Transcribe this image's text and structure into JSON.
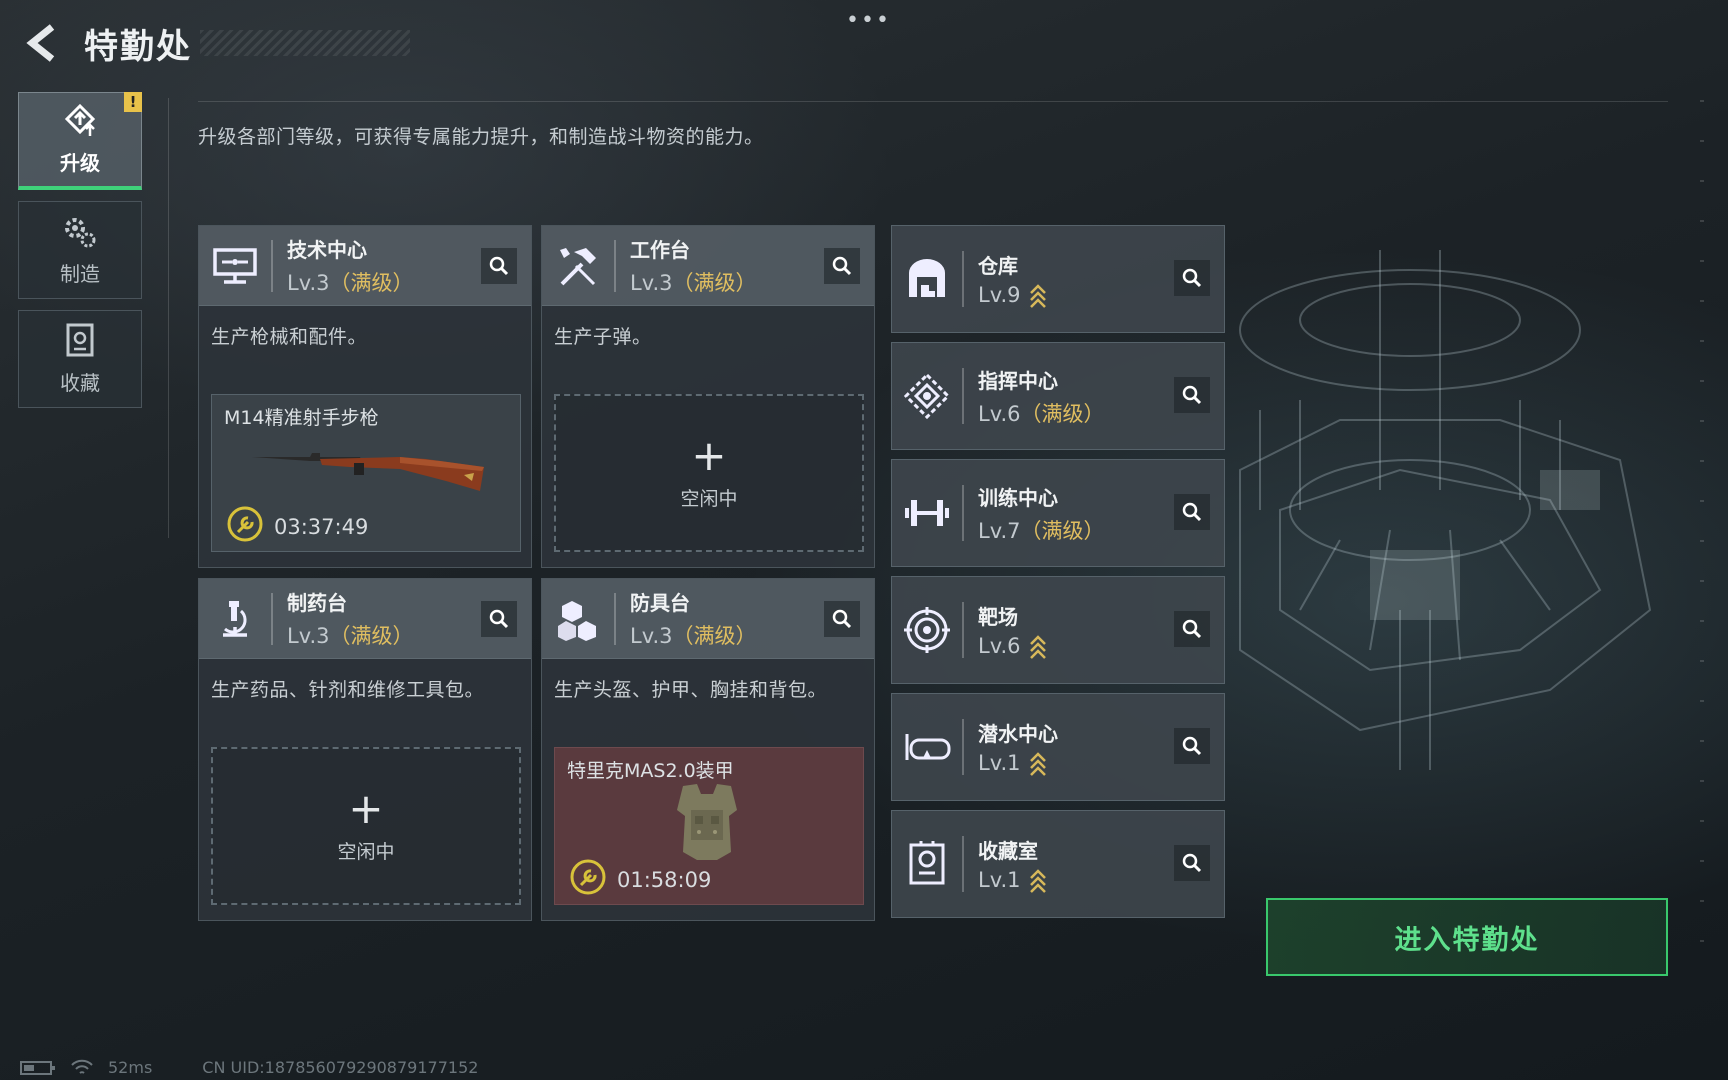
{
  "header": {
    "title": "特勤处",
    "menu_dots": "•••"
  },
  "nav": {
    "tabs": [
      {
        "label": "升级",
        "active": true,
        "badge": "!"
      },
      {
        "label": "制造"
      },
      {
        "label": "收藏"
      }
    ]
  },
  "description": "升级各部门等级，可获得专属能力提升，和制造战斗物资的能力。",
  "cards": {
    "tech_center": {
      "name": "技术中心",
      "level": "Lv.3",
      "full": "（满级）",
      "desc": "生产枪械和配件。",
      "slot": {
        "item": "M14精准射手步枪",
        "timer": "03:37:49"
      }
    },
    "workbench": {
      "name": "工作台",
      "level": "Lv.3",
      "full": "（满级）",
      "desc": "生产子弹。",
      "slot": {
        "plus": "+",
        "idle": "空闲中"
      }
    },
    "pharmacy": {
      "name": "制药台",
      "level": "Lv.3",
      "full": "（满级）",
      "desc": "生产药品、针剂和维修工具包。",
      "slot": {
        "plus": "+",
        "idle": "空闲中"
      }
    },
    "armory": {
      "name": "防具台",
      "level": "Lv.3",
      "full": "（满级）",
      "desc": "生产头盔、护甲、胸挂和背包。",
      "slot": {
        "item": "特里克MAS2.0装甲",
        "timer": "01:58:09"
      }
    }
  },
  "side_cards": [
    {
      "name": "仓库",
      "level": "Lv.9",
      "full": "",
      "upgradable": true
    },
    {
      "name": "指挥中心",
      "level": "Lv.6",
      "full": "（满级）",
      "upgradable": false
    },
    {
      "name": "训练中心",
      "level": "Lv.7",
      "full": "（满级）",
      "upgradable": false
    },
    {
      "name": "靶场",
      "level": "Lv.6",
      "full": "",
      "upgradable": true
    },
    {
      "name": "潜水中心",
      "level": "Lv.1",
      "full": "",
      "upgradable": true
    },
    {
      "name": "收藏室",
      "level": "Lv.1",
      "full": "",
      "upgradable": true
    }
  ],
  "enter_button": "进入特勤处",
  "footer": {
    "ping": "52ms",
    "uid": "CN UID:1878560792908791771​52"
  },
  "colors": {
    "accent_green": "#3fd27a",
    "full_level": "#e0be60",
    "armor_slot": "#5a3a3e"
  }
}
